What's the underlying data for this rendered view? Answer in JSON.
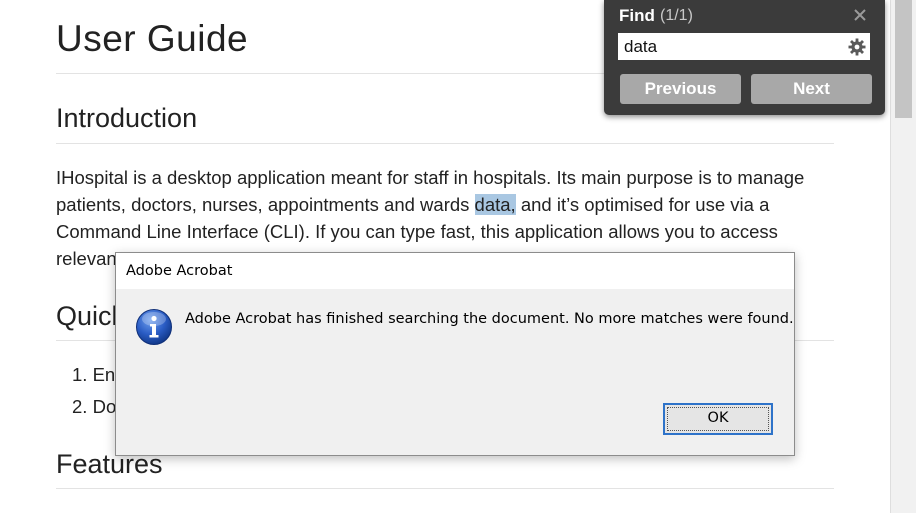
{
  "document": {
    "title": "User Guide",
    "sections": {
      "introduction": "Introduction",
      "quick_start_partial": "Quick",
      "features": "Features"
    },
    "paragraph": {
      "before_match": "IHospital is a desktop application meant for staff in hospitals. Its main purpose is to manage patients, doctors, nurses, appointments and wards ",
      "match": "data,",
      "after_match": " and it’s optimised for use via a Command Line Interface (CLI). If you can type fast, this application allows you to access",
      "last_line_partial": "relevan"
    },
    "list": [
      {
        "num": "1.",
        "text": "Ens"
      },
      {
        "num": "2.",
        "text": "Do"
      }
    ]
  },
  "find_panel": {
    "title": "Find",
    "count": "(1/1)",
    "query": "data",
    "previous_label": "Previous",
    "next_label": "Next",
    "close_icon": "close-icon",
    "settings_icon": "gear-icon"
  },
  "dialog": {
    "title": "Adobe Acrobat",
    "message": "Adobe Acrobat has finished searching the document. No more matches were found.",
    "ok_label": "OK",
    "icon": "info-icon"
  },
  "colors": {
    "highlight": "#a9c7e2",
    "find_panel_bg": "#3b3b3b",
    "find_button_bg": "#a8a8a8",
    "dialog_bg": "#f0f0f0",
    "ok_button_border": "#2e73c9",
    "info_icon_blue": "#1f4fb3"
  }
}
